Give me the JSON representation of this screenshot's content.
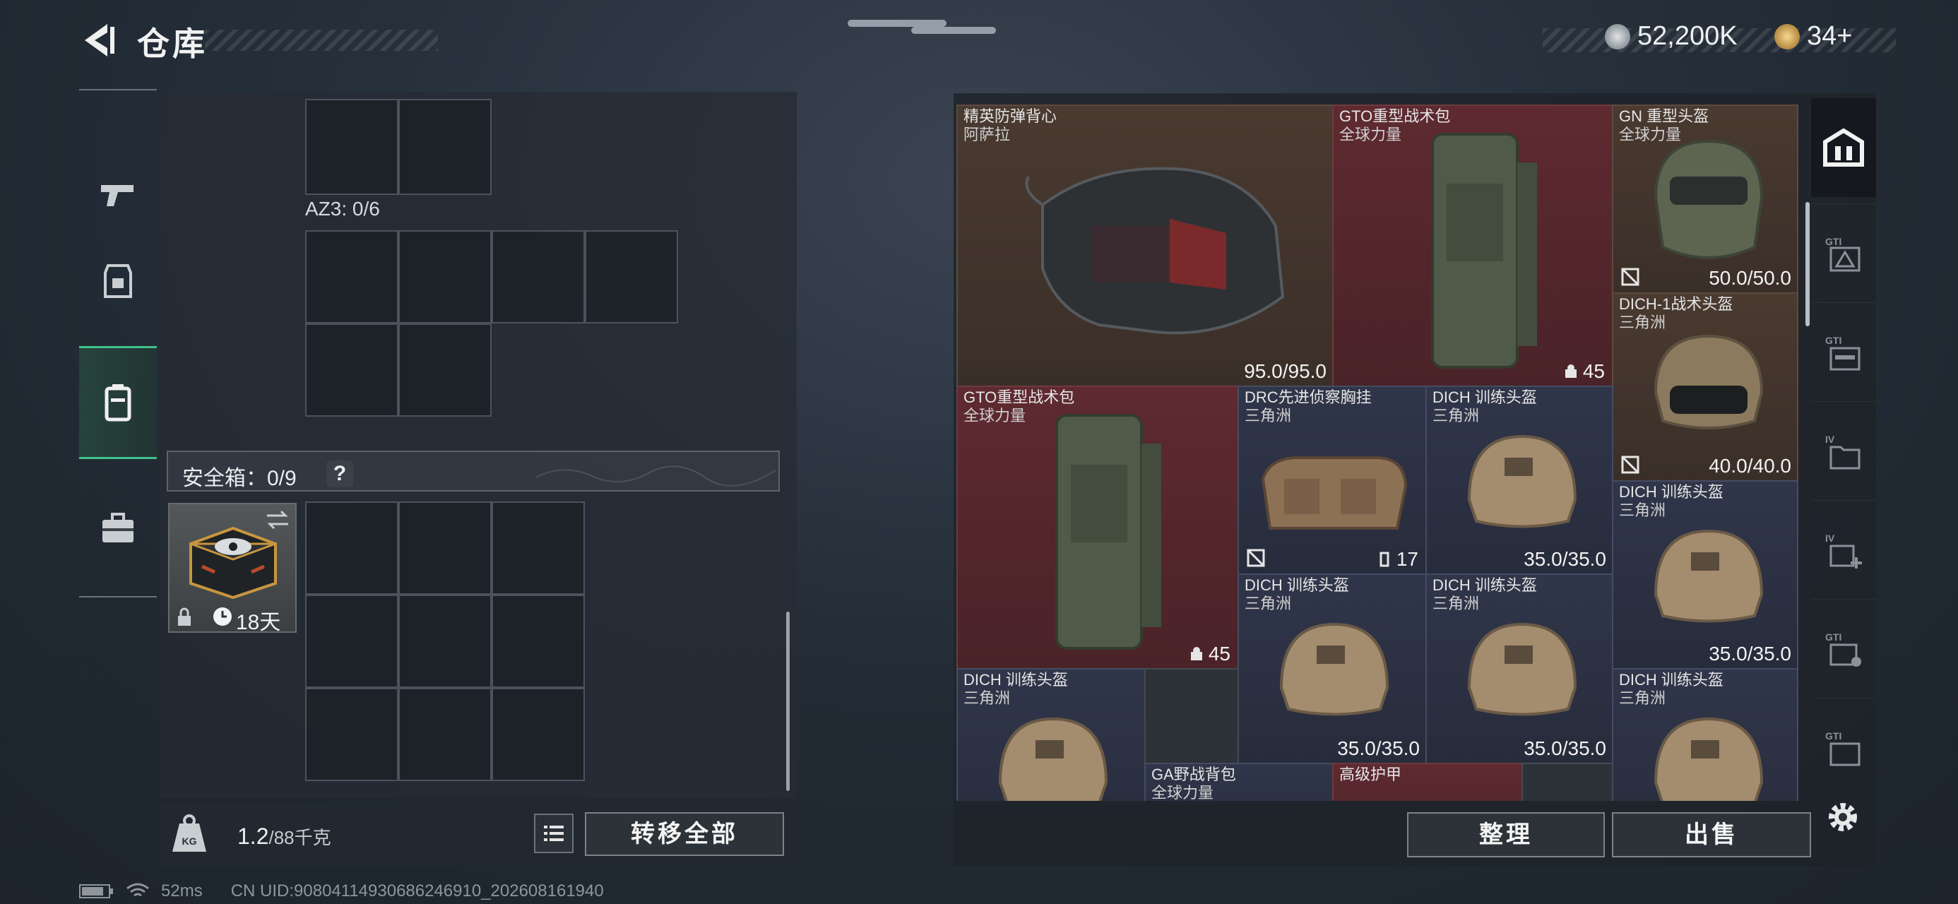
{
  "header": {
    "title": "仓库",
    "money": "52,200K",
    "tokens": "34+"
  },
  "left_rail": {
    "items": [
      {
        "name": "weapon",
        "active": false
      },
      {
        "name": "equipment",
        "active": false
      },
      {
        "name": "backpack",
        "active": true
      },
      {
        "name": "briefcase",
        "active": false
      }
    ]
  },
  "left_panel": {
    "container_label": "AZ3: 0/6",
    "safe_box": {
      "label": "安全箱：0/9",
      "help": "?",
      "timer": "18天"
    },
    "weight": {
      "current": "1.2",
      "capacity": "/88千克"
    },
    "transfer_all": "转移全部"
  },
  "inventory": {
    "items": [
      {
        "name": "精英防弹背心",
        "sub": "阿萨拉",
        "durability": "95.0/95.0",
        "color": "brown"
      },
      {
        "name": "GTO重型战术包",
        "sub": "全球力量",
        "count": "45",
        "color": "red"
      },
      {
        "name": "GN 重型头盔",
        "sub": "全球力量",
        "durability": "50.0/50.0",
        "color": "brown"
      },
      {
        "name": "DICH-1战术头盔",
        "sub": "三角洲",
        "durability": "40.0/40.0",
        "color": "brown"
      },
      {
        "name": "GTO重型战术包",
        "sub": "全球力量",
        "count": "45",
        "color": "red"
      },
      {
        "name": "DRC先进侦察胸挂",
        "sub": "三角洲",
        "count": "17",
        "color": "navy"
      },
      {
        "name": "DICH 训练头盔",
        "sub": "三角洲",
        "durability": "35.0/35.0",
        "color": "navy"
      },
      {
        "name": "DICH 训练头盔",
        "sub": "三角洲",
        "durability": "35.0/35.0",
        "color": "navy"
      },
      {
        "name": "DICH 训练头盔",
        "sub": "三角洲",
        "durability": "35.0/35.0",
        "color": "navy"
      },
      {
        "name": "DICH 训练头盔",
        "sub": "三角洲",
        "durability": "35.0/35.0",
        "color": "navy"
      },
      {
        "name": "DICH 训练头盔",
        "sub": "三角洲",
        "color": "navy"
      },
      {
        "name": "DICH 训练头盔",
        "sub": "三角洲",
        "color": "navy"
      },
      {
        "name": "GA野战背包",
        "sub": "全球力量",
        "color": "navy"
      },
      {
        "name": "高级护甲",
        "sub": "",
        "color": "red"
      }
    ],
    "sort_button": "整理",
    "sell_button": "出售"
  },
  "right_rail": {
    "items": [
      "vault",
      "GTI",
      "GTI",
      "IV",
      "IV",
      "GTI",
      "GTI"
    ]
  },
  "status_bar": {
    "ping": "52ms",
    "uid": "CN UID:90804114930686246910_202608161940"
  }
}
